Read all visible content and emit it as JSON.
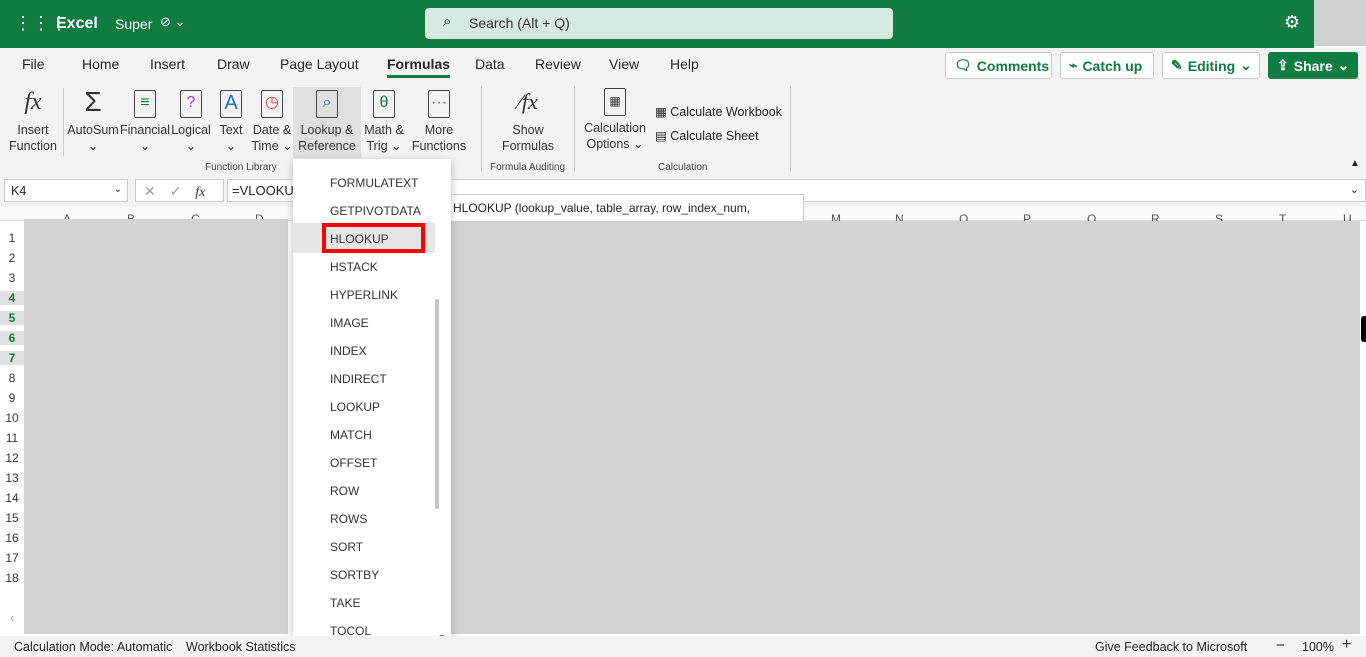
{
  "header": {
    "app": "Excel",
    "doc": "Super",
    "search": "Search (Alt + Q)"
  },
  "tabs": [
    "File",
    "Home",
    "Insert",
    "Draw",
    "Page Layout",
    "Formulas",
    "Data",
    "Review",
    "View",
    "Help"
  ],
  "active_tab": "Formulas",
  "actions": {
    "comments": "Comments",
    "catchup": "Catch up",
    "editing": "Editing",
    "share": "Share"
  },
  "ribbon": {
    "insert_function": [
      "Insert",
      "Function"
    ],
    "autosum": "AutoSum",
    "financial": "Financial",
    "logical": "Logical",
    "text": "Text",
    "datetime": [
      "Date &",
      "Time"
    ],
    "lookup": [
      "Lookup &",
      "Reference"
    ],
    "math": [
      "Math &",
      "Trig"
    ],
    "more": [
      "More",
      "Functions"
    ],
    "show_formulas": [
      "Show",
      "Formulas"
    ],
    "calc_options": [
      "Calculation",
      "Options"
    ],
    "calc_workbook": "Calculate Workbook",
    "calc_sheet": "Calculate Sheet",
    "groups": {
      "library": "Function Library",
      "auditing": "Formula Auditing",
      "calculation": "Calculation"
    }
  },
  "formula_bar": {
    "name_box": "K4",
    "formula": "=VLOOKUP"
  },
  "menu_items": [
    "FORMULATEXT",
    "GETPIVOTDATA",
    "HLOOKUP",
    "HSTACK",
    "HYPERLINK",
    "IMAGE",
    "INDEX",
    "INDIRECT",
    "LOOKUP",
    "MATCH",
    "OFFSET",
    "ROW",
    "ROWS",
    "SORT",
    "SORTBY",
    "TAKE",
    "TOCOL"
  ],
  "highlighted_item": "HLOOKUP",
  "tooltip": "HLOOKUP (lookup_value, table_array, row_index_num,",
  "columns_left": [
    "A",
    "B",
    "C",
    "D"
  ],
  "columns_right": [
    "M",
    "N",
    "O",
    "P",
    "Q",
    "R",
    "S",
    "T",
    "U"
  ],
  "rows": [
    "1",
    "2",
    "3",
    "4",
    "5",
    "6",
    "7",
    "8",
    "9",
    "10",
    "11",
    "12",
    "13",
    "14",
    "15",
    "16",
    "17",
    "18"
  ],
  "selected_rows": [
    "4",
    "5",
    "6",
    "7"
  ],
  "status": {
    "mode": "Calculation Mode: Automatic",
    "stats": "Workbook Statistics",
    "feedback": "Give Feedback to Microsoft",
    "zoom_out": "−",
    "zoom": "100%",
    "zoom_in": "+"
  },
  "colors": {
    "brand": "#107c41",
    "highlight": "#ff0000"
  }
}
